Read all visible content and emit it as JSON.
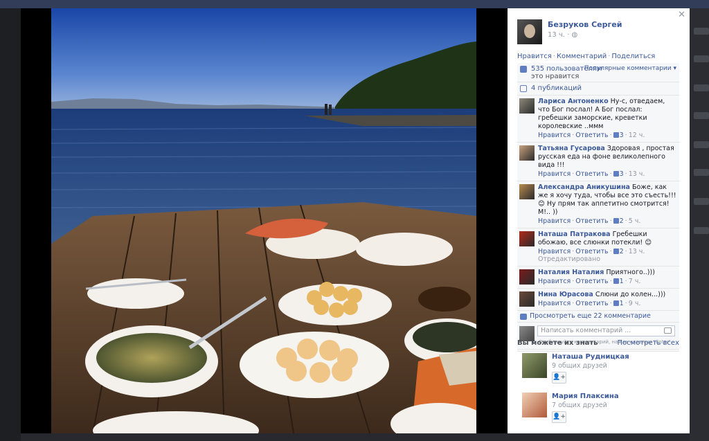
{
  "post": {
    "author": "Безруков Сергей",
    "time": "13 ч.",
    "privacy_icon": "globe-icon",
    "actions": [
      "Нравится",
      "Комментарий",
      "Поделиться"
    ]
  },
  "likes": {
    "count_text": "535 пользователям",
    "suffix": "это нравится",
    "popular_label": "Популярные комментарии ▾"
  },
  "shares": {
    "text": "4 публикаций"
  },
  "comment_actions": {
    "like": "Нравится",
    "reply": "Ответить"
  },
  "comments": [
    {
      "name": "Лариса Антоненко",
      "text": "Ну-с, отведаем, что Бог послал! А Бог послал: гребешки заморские, креветки королевские ..ммм",
      "likes": "3",
      "time": "12 ч.",
      "edited": "",
      "avatar_color": "#8e8a7a"
    },
    {
      "name": "Татьяна Гусарова",
      "text": "Здоровая , простая русская еда на фоне великолепного вида !!!",
      "likes": "3",
      "time": "13 ч.",
      "edited": "",
      "avatar_color": "#c9a27e"
    },
    {
      "name": "Александра Аникушина",
      "text": "Боже, как же я хочу туда, чтобы все это съесть!!! 😊 Ну прям так аппетитно смотрится! М!.. ))",
      "likes": "2",
      "time": "5 ч.",
      "edited": "",
      "avatar_color": "#b78b4f"
    },
    {
      "name": "Наташа Патракова",
      "text": "Гребешки обожаю, все слюнки потекли! 😊",
      "likes": "2",
      "time": "13 ч.",
      "edited": "Отредактировано",
      "avatar_color": "#b32a1b"
    },
    {
      "name": "Наталия Наталия",
      "text": "Приятного..)))",
      "likes": "1",
      "time": "7 ч.",
      "edited": "",
      "avatar_color": "#7a1c1c"
    },
    {
      "name": "Нина Юрасова",
      "text": "Слюни до колен...)))",
      "likes": "1",
      "time": "9 ч.",
      "edited": "",
      "avatar_color": "#6b4a3a"
    }
  ],
  "more_comments": "Просмотреть еще 22 комментарие",
  "write": {
    "placeholder": "Написать комментарий ...",
    "hint": "Опубликуйте комментарий, нажав клавишу \"Enter\"."
  },
  "pymk": {
    "title": "Вы можете их знать",
    "see_all": "Посмотреть всех",
    "people": [
      {
        "name": "Наташа Рудницкая",
        "mutual": "9 общих друзей",
        "avatar_color": "#5d6b4a"
      },
      {
        "name": "Мария Плаксина",
        "mutual": "7 общих друзей",
        "avatar_color": "#c98f6a"
      }
    ],
    "add_icon": "add-friend-icon"
  },
  "colors": {
    "link": "#3b5998",
    "meta": "#9197a3",
    "ufi_bg": "#f6f7f9"
  }
}
